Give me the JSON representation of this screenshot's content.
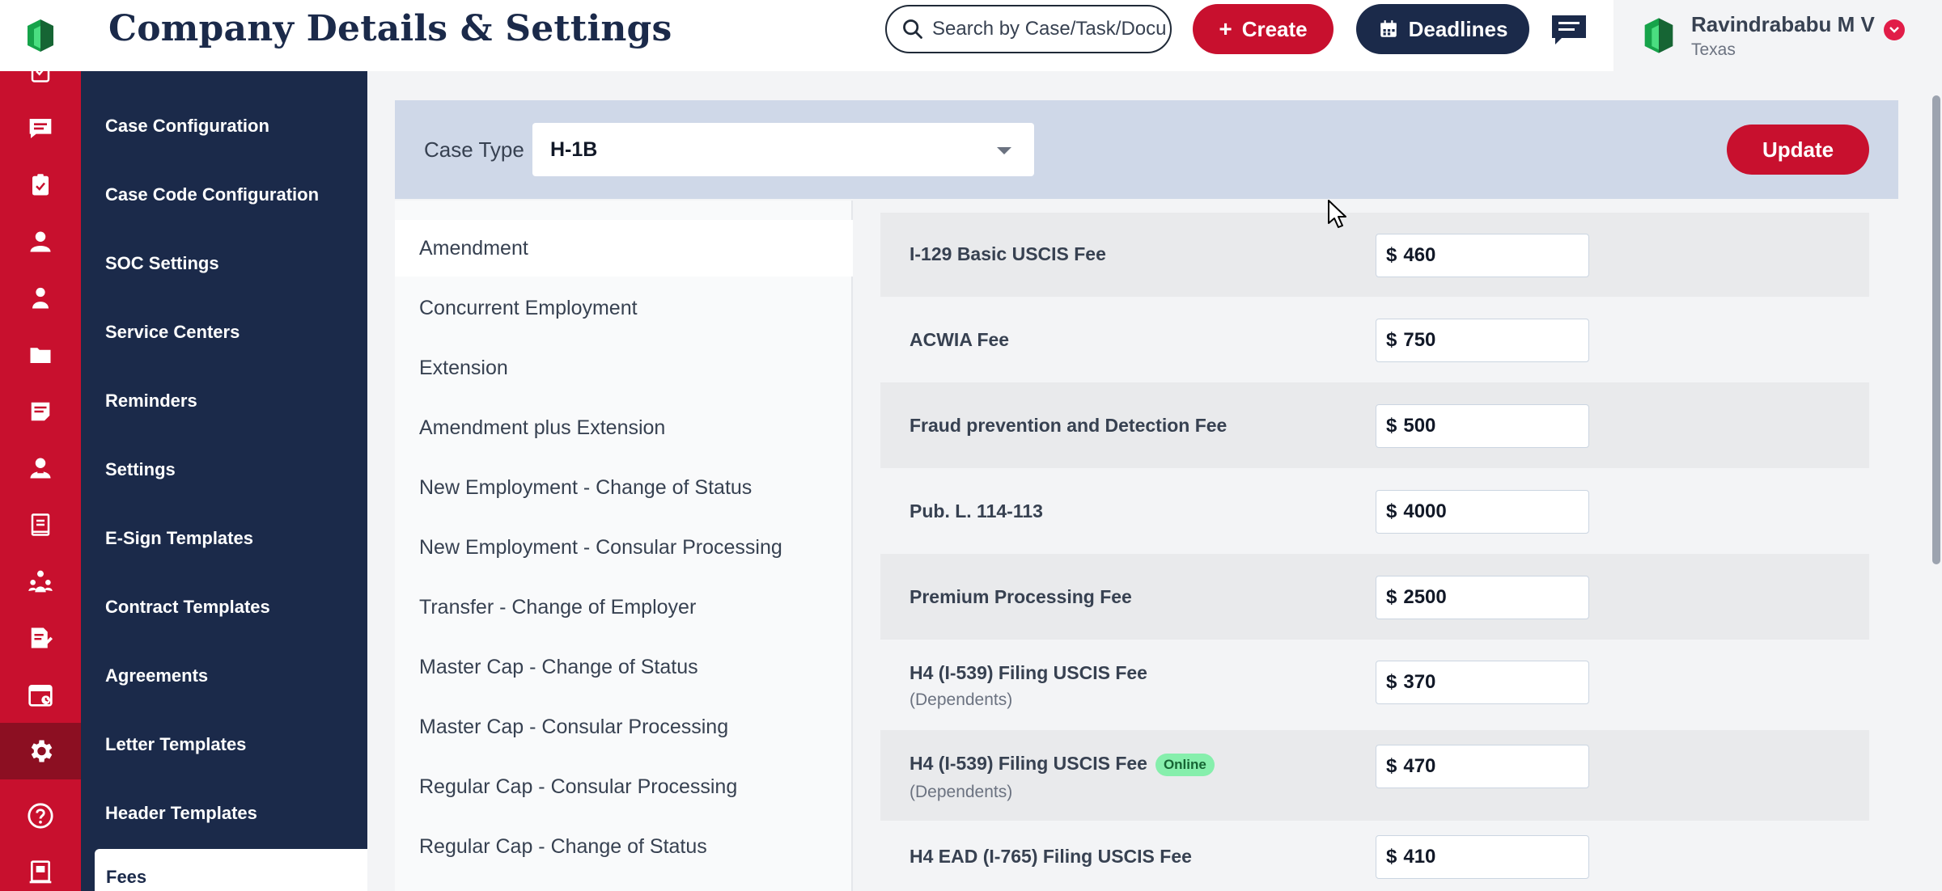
{
  "header": {
    "title": "Company Details & Settings",
    "search_placeholder": "Search by Case/Task/Document",
    "create_label": "Create",
    "deadlines_label": "Deadlines",
    "user_name": "Ravindrababu M V",
    "user_location": "Texas"
  },
  "rail": {
    "icons": [
      "checklist-icon",
      "message-icon",
      "clipboard-icon",
      "user-icon",
      "person-icon",
      "folder-icon",
      "notes-icon",
      "profile-icon",
      "book-icon",
      "team-icon",
      "document-edit-icon",
      "calendar-icon",
      "gear-icon",
      "help-icon",
      "ledger-icon"
    ],
    "active_icon": "gear-icon"
  },
  "nav": {
    "items": [
      "Case Configuration",
      "Case Code Configuration",
      "SOC Settings",
      "Service Centers",
      "Reminders",
      "Settings",
      "E-Sign Templates",
      "Contract Templates",
      "Agreements",
      "Letter Templates",
      "Header Templates"
    ],
    "active_item": "Fees"
  },
  "filter": {
    "case_type_label": "Case Type",
    "case_type_value": "H-1B",
    "update_label": "Update"
  },
  "subtypes": {
    "items": [
      "Amendment",
      "Concurrent Employment",
      "Extension",
      "Amendment plus Extension",
      "New Employment - Change of Status",
      "New Employment - Consular Processing",
      "Transfer - Change of Employer",
      "Master Cap - Change of Status",
      "Master Cap - Consular Processing",
      "Regular Cap - Consular Processing",
      "Regular Cap - Change of Status"
    ],
    "active": "Amendment"
  },
  "fees": {
    "currency": "$",
    "rows": [
      {
        "label": "I-129 Basic USCIS Fee",
        "value": "460"
      },
      {
        "label": "ACWIA Fee",
        "value": "750"
      },
      {
        "label": "Fraud prevention and Detection Fee",
        "value": "500"
      },
      {
        "label": "Pub. L. 114-113",
        "value": "4000"
      },
      {
        "label": "Premium Processing Fee",
        "value": "2500"
      },
      {
        "label": "H4 (I-539) Filing USCIS Fee",
        "sub": "(Dependents)",
        "value": "370"
      },
      {
        "label": "H4 (I-539) Filing USCIS Fee",
        "badge": "Online",
        "sub": "(Dependents)",
        "value": "470"
      },
      {
        "label": "H4 EAD (I-765) Filing USCIS Fee",
        "value": "410"
      }
    ]
  },
  "colors": {
    "brand_red": "#c8102e",
    "navy": "#1b2a4a",
    "online_badge": "#86efac"
  }
}
